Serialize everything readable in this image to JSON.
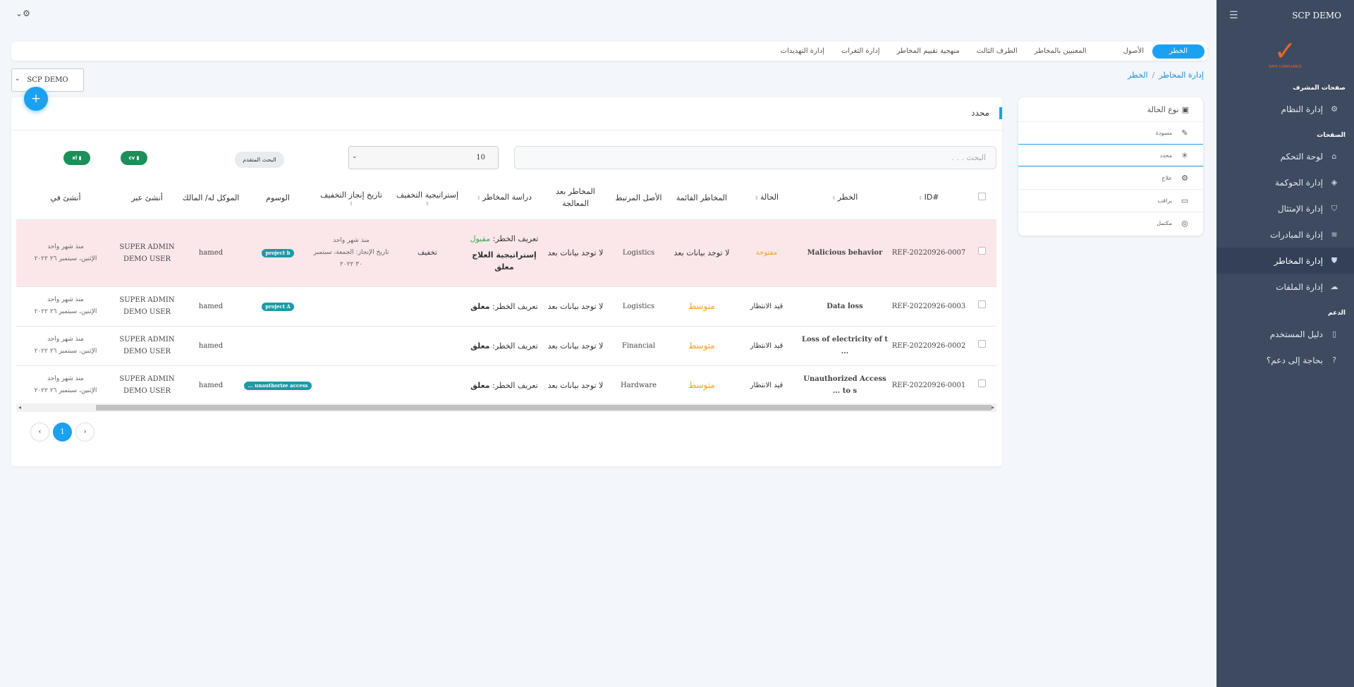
{
  "sidebar": {
    "brand": "SCP DEMO",
    "logo_text": "SAFE COMPLIANCE",
    "section_admin": "صفحات المشرف",
    "admin_items": [
      {
        "label": "إدارة النظام",
        "icon": "gear-icon"
      }
    ],
    "section_pages": "الصفحات",
    "items": [
      {
        "label": "لوحة التحكم",
        "icon": "home-icon"
      },
      {
        "label": "إدارة الحوكمة",
        "icon": "cube-icon"
      },
      {
        "label": "إدارة الإمتثال",
        "icon": "shield-check-icon"
      },
      {
        "label": "إدارة المبادرات",
        "icon": "layers-icon"
      },
      {
        "label": "إدارة المخاطر",
        "icon": "shield-icon"
      },
      {
        "label": "إدارة الملفات",
        "icon": "cloud-upload-icon"
      }
    ],
    "section_support": "الدعم",
    "support_items": [
      {
        "label": "دليل المستخدم",
        "icon": "book-icon"
      },
      {
        "label": "بحاجة إلى دعم؟",
        "icon": "help-icon"
      }
    ]
  },
  "tabs": [
    "الخطر",
    "الأصول",
    "المعنيين بالمخاطر",
    "الطرف الثالث",
    "منهجية تقييم المخاطر",
    "إدارة الثغرات",
    "إدارة التهديدات"
  ],
  "breadcrumb": {
    "root": "إدارة المخاطر",
    "current": "الخطر"
  },
  "project_select": {
    "value": "SCP DEMO"
  },
  "status_panel": {
    "title": "نوع الحالة",
    "items": [
      {
        "label": "مسودة",
        "icon": "feather-icon"
      },
      {
        "label": "محدد",
        "icon": "loader-icon"
      },
      {
        "label": "علاج",
        "icon": "gear-icon"
      },
      {
        "label": "يراقب",
        "icon": "clipboard-icon"
      },
      {
        "label": "مكتمل",
        "icon": "target-icon"
      }
    ]
  },
  "card": {
    "title": "محدد",
    "add_label": "+",
    "search_placeholder": "البحث . . .",
    "page_size": "10",
    "advanced_search": "البحث المتقدم",
    "export_1": "xl",
    "export_2": "cv"
  },
  "table": {
    "headers": [
      "#ID",
      "الخطر",
      "الحالة",
      "المخاطر القائمة",
      "الأصل المرتبط",
      "المخاطر بعد المعالجة",
      "دراسة المخاطر",
      "إستراتيجية التخفيف",
      "تاريخ إنجاز التخفيف",
      "الوسوم",
      "الموكل له/ المالك",
      "أنشئ عبر",
      "أنشئ في"
    ],
    "rows": [
      {
        "id": "REF-20220926-0007",
        "risk": "Malicious behavior",
        "status": "مفتوحة",
        "inherent": "لا توجد بيانات بعد",
        "asset": "Logistics",
        "residual": "لا توجد بيانات بعد",
        "study_label": "تعريف الخطر:",
        "study_value": "مقبول",
        "study_extra": "إستراتيجية العلاج معلق",
        "mitigation": "تخفيف",
        "mit_date_ago": "منذ شهر واحد",
        "mit_date_full": "تاريخ الإنجاز: الجمعة، سبتمبر ٣٠ ٢٠٢٢",
        "tag": "project b",
        "owner": "hamed",
        "created_by": "SUPER ADMIN DEMO USER",
        "created_ago": "منذ شهر واحد",
        "created_full": "الإثنين، سبتمبر ٢٦ ٢٠٢٢"
      },
      {
        "id": "REF-20220926-0003",
        "risk": "Data loss",
        "status": "قيد الانتظار",
        "inherent": "متوسط",
        "asset": "Logistics",
        "residual": "لا توجد بيانات بعد",
        "study_label": "تعريف الخطر:",
        "study_value": "معلق",
        "study_extra": "",
        "mitigation": "",
        "mit_date_ago": "",
        "mit_date_full": "",
        "tag": "project A",
        "owner": "hamed",
        "created_by": "SUPER ADMIN DEMO USER",
        "created_ago": "منذ شهر واحد",
        "created_full": "الإثنين، سبتمبر ٢٦ ٢٠٢٢"
      },
      {
        "id": "REF-20220926-0002",
        "risk": "Loss of electricity of t ...",
        "status": "قيد الانتظار",
        "inherent": "متوسط",
        "asset": "Financial",
        "residual": "لا توجد بيانات بعد",
        "study_label": "تعريف الخطر:",
        "study_value": "معلق",
        "study_extra": "",
        "mitigation": "",
        "mit_date_ago": "",
        "mit_date_full": "",
        "tag": "",
        "owner": "hamed",
        "created_by": "SUPER ADMIN DEMO USER",
        "created_ago": "منذ شهر واحد",
        "created_full": "الإثنين، سبتمبر ٢٦ ٢٠٢٢"
      },
      {
        "id": "REF-20220926-0001",
        "risk": "Unauthorized Access to s ...",
        "status": "قيد الانتظار",
        "inherent": "متوسط",
        "asset": "Hardware",
        "residual": "لا توجد بيانات بعد",
        "study_label": "تعريف الخطر:",
        "study_value": "معلق",
        "study_extra": "",
        "mitigation": "",
        "mit_date_ago": "",
        "mit_date_full": "",
        "tag": "unauthorize access ...",
        "owner": "hamed",
        "created_by": "SUPER ADMIN DEMO USER",
        "created_ago": "منذ شهر واحد",
        "created_full": "الإثنين، سبتمبر ٢٦ ٢٠٢٢"
      }
    ]
  },
  "pager": {
    "prev": "‹",
    "current": "1",
    "next": "›"
  },
  "colors": {
    "accent": "#1ba1f2",
    "sidebar": "#3d4a5f",
    "medium": "#f0a020",
    "accepted": "#3aa657",
    "highlight_row": "#fbe7ea"
  }
}
